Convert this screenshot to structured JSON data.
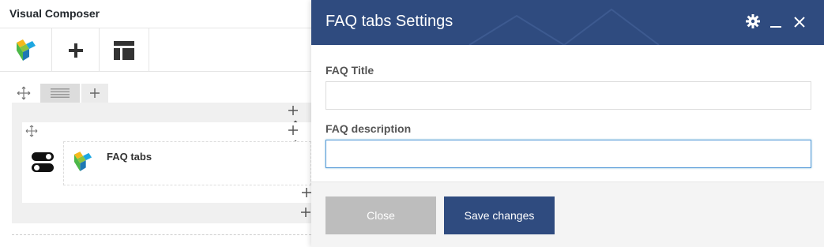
{
  "editor": {
    "title": "Visual Composer",
    "toolbar": {
      "items": [
        {
          "icon": "vc-logo-icon"
        },
        {
          "icon": "add-element-icon"
        },
        {
          "icon": "templates-icon"
        }
      ]
    },
    "element": {
      "name": "FAQ tabs",
      "icon": "vc-logo-icon"
    }
  },
  "modal": {
    "title": "FAQ tabs Settings",
    "header_icons": [
      "gear-icon",
      "minimize-icon",
      "close-icon"
    ],
    "fields": [
      {
        "label": "FAQ Title",
        "value": "",
        "placeholder": ""
      },
      {
        "label": "FAQ description",
        "value": "",
        "placeholder": ""
      }
    ],
    "buttons": {
      "close_label": "Close",
      "save_label": "Save changes"
    }
  },
  "colors": {
    "modal_header": "#2f4b7f",
    "save_button": "#2f4b7f",
    "close_button": "#bdbdbd",
    "input_focus": "#5b9dd9"
  }
}
